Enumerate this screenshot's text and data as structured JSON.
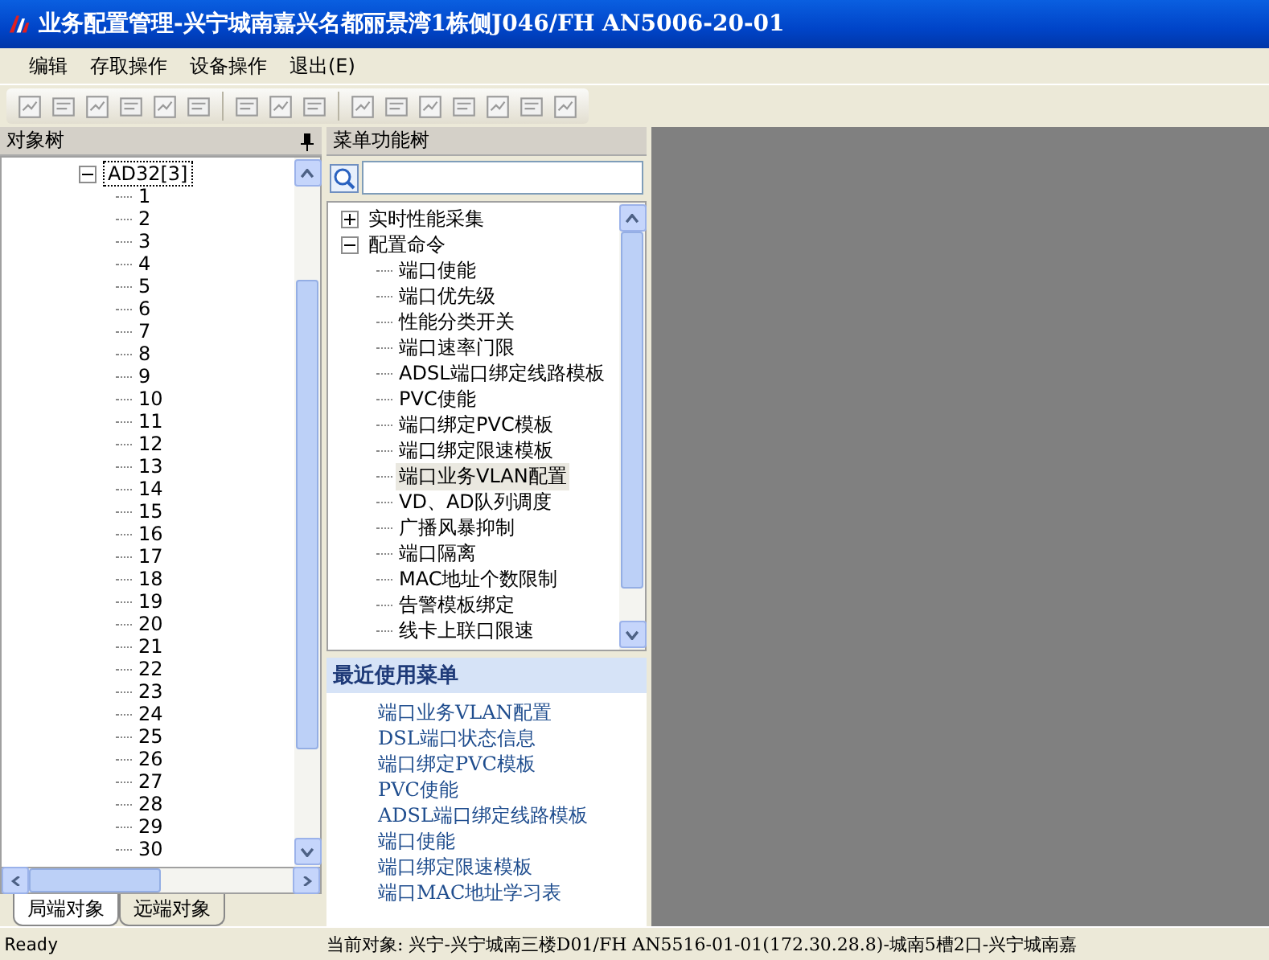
{
  "window": {
    "title": "业务配置管理-兴宁城南嘉兴名都丽景湾1栋侧J046/FH AN5006-20-01"
  },
  "menu": [
    {
      "label": "编辑"
    },
    {
      "label": "存取操作"
    },
    {
      "label": "设备操作"
    },
    {
      "label": "退出(E)"
    }
  ],
  "object_tree": {
    "title": "对象树",
    "nodes": [
      {
        "label": "AD32[3]",
        "expanded": true,
        "selected": true,
        "children": [
          {
            "label": "1"
          },
          {
            "label": "2"
          },
          {
            "label": "3"
          },
          {
            "label": "4"
          },
          {
            "label": "5"
          },
          {
            "label": "6"
          },
          {
            "label": "7"
          },
          {
            "label": "8"
          },
          {
            "label": "9"
          },
          {
            "label": "10"
          },
          {
            "label": "11"
          },
          {
            "label": "12"
          },
          {
            "label": "13"
          },
          {
            "label": "14"
          },
          {
            "label": "15"
          },
          {
            "label": "16"
          },
          {
            "label": "17"
          },
          {
            "label": "18"
          },
          {
            "label": "19"
          },
          {
            "label": "20"
          },
          {
            "label": "21"
          },
          {
            "label": "22"
          },
          {
            "label": "23"
          },
          {
            "label": "24"
          },
          {
            "label": "25"
          },
          {
            "label": "26"
          },
          {
            "label": "27"
          },
          {
            "label": "28"
          },
          {
            "label": "29"
          },
          {
            "label": "30"
          }
        ]
      }
    ],
    "tabs": [
      {
        "label": "局端对象",
        "selected": true
      },
      {
        "label": "远端对象",
        "selected": false
      }
    ]
  },
  "menu_tree": {
    "title": "菜单功能树",
    "nodes": [
      {
        "label": "实时性能采集",
        "expanded": false,
        "selected": false
      },
      {
        "label": "配置命令",
        "expanded": true,
        "selected": false,
        "children": [
          {
            "label": "端口使能",
            "selected": false
          },
          {
            "label": "端口优先级",
            "selected": false
          },
          {
            "label": "性能分类开关",
            "selected": false
          },
          {
            "label": "端口速率门限",
            "selected": false
          },
          {
            "label": "ADSL端口绑定线路模板",
            "selected": false
          },
          {
            "label": "PVC使能",
            "selected": false
          },
          {
            "label": "端口绑定PVC模板",
            "selected": false
          },
          {
            "label": "端口绑定限速模板",
            "selected": false
          },
          {
            "label": "端口业务VLAN配置",
            "selected": true
          },
          {
            "label": "VD、AD队列调度",
            "selected": false
          },
          {
            "label": "广播风暴抑制",
            "selected": false
          },
          {
            "label": "端口隔离",
            "selected": false
          },
          {
            "label": "MAC地址个数限制",
            "selected": false
          },
          {
            "label": "告警模板绑定",
            "selected": false
          },
          {
            "label": "线卡上联口限速",
            "selected": false
          }
        ]
      }
    ]
  },
  "recent": {
    "title": "最近使用菜单",
    "items": [
      "端口业务VLAN配置",
      "DSL端口状态信息",
      "端口绑定PVC模板",
      "PVC使能",
      "ADSL端口绑定线路模板",
      "端口使能",
      "端口绑定限速模板",
      "端口MAC地址学习表"
    ]
  },
  "status_bar": {
    "state": "Ready",
    "current_object": "当前对象: 兴宁-兴宁城南三楼D01/FH AN5516-01-01(172.30.28.8)-城南5槽2口-兴宁城南嘉"
  }
}
